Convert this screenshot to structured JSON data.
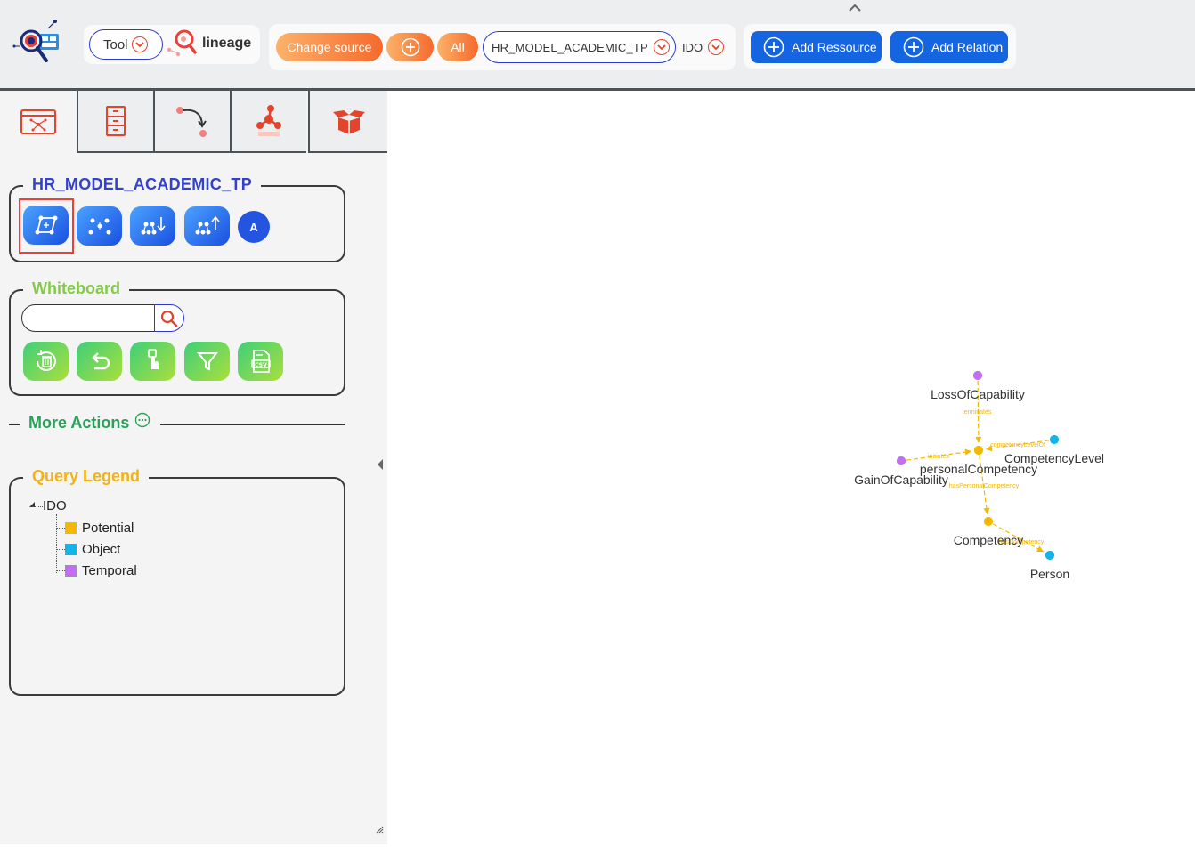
{
  "toolbar": {
    "tool_label": "Tool",
    "lineage_label": "lineage",
    "change_source_label": "Change source",
    "all_label": "All",
    "source_value": "HR_MODEL_ACADEMIC_TP",
    "ido_label": "IDO",
    "add_resource_label": "Add Ressource",
    "add_relation_label": "Add Relation"
  },
  "sidebar": {
    "tabs": [
      {
        "name": "graph-tab",
        "icon": "graph-window-icon",
        "active": true
      },
      {
        "name": "cabinet-tab",
        "icon": "file-cabinet-icon",
        "active": false
      },
      {
        "name": "lineage-path-tab",
        "icon": "curved-arrow-icon",
        "active": false
      },
      {
        "name": "sparql-tab",
        "icon": "sparql-icon",
        "active": false
      },
      {
        "name": "box-tab",
        "icon": "open-box-icon",
        "active": false
      }
    ],
    "model_section": {
      "title": "HR_MODEL_ACADEMIC_TP",
      "a_button_label": "A"
    },
    "whiteboard_section": {
      "title": "Whiteboard",
      "search_value": "",
      "buttons": [
        "trash-reset-icon",
        "undo-icon",
        "hand-pointer-icon",
        "filter-icon",
        "csv-icon"
      ]
    },
    "more_actions_label": "More Actions",
    "query_legend": {
      "title": "Query Legend",
      "root": "IDO",
      "items": [
        {
          "label": "Potential",
          "color": "#f5b800"
        },
        {
          "label": "Object",
          "color": "#12b5e5"
        },
        {
          "label": "Temporal",
          "color": "#c06ff0"
        }
      ]
    }
  },
  "graph": {
    "nodes": [
      {
        "id": "LossOfCapability",
        "label": "LossOfCapability",
        "type": "Temporal"
      },
      {
        "id": "personalCompetency",
        "label": "personalCompetency",
        "type": "Potential"
      },
      {
        "id": "CompetencyLevel",
        "label": "CompetencyLevel",
        "type": "Object"
      },
      {
        "id": "GainOfCapability",
        "label": "GainOfCapability",
        "type": "Temporal"
      },
      {
        "id": "Competency",
        "label": "Competency",
        "type": "Potential"
      },
      {
        "id": "Person",
        "label": "Person",
        "type": "Object"
      }
    ],
    "edges": [
      {
        "from": "LossOfCapability",
        "to": "personalCompetency",
        "label": "terminates"
      },
      {
        "from": "CompetencyLevel",
        "to": "personalCompetency",
        "label": "competencyLevelOf"
      },
      {
        "from": "GainOfCapability",
        "to": "personalCompetency",
        "label": "initiates"
      },
      {
        "from": "personalCompetency",
        "to": "Competency",
        "label": "hasPersonalCompetency"
      },
      {
        "from": "Competency",
        "to": "Person",
        "label": "hasCompetency"
      }
    ],
    "colors": {
      "Potential": "#f5b800",
      "Object": "#12b5e5",
      "Temporal": "#c06ff0",
      "edge": "#f5b800"
    }
  }
}
